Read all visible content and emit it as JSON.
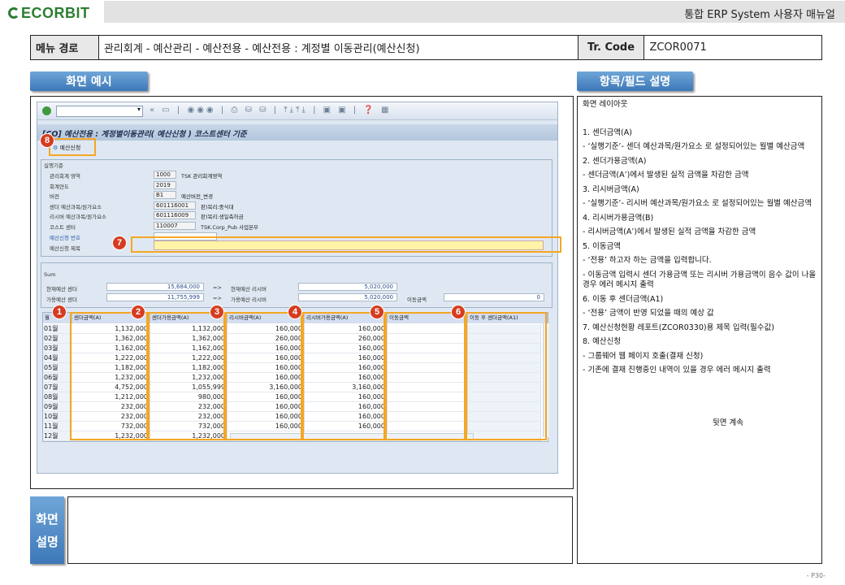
{
  "header": {
    "logo_text": "ECORBIT",
    "doc_title": "통합 ERP System 사용자 매뉴얼"
  },
  "menu": {
    "path_label": "메뉴 경로",
    "path_value": "관리회계 - 예산관리 - 예산전용 - 예산전용 : 계정별 이동관리(예산신청)",
    "tcode_label": "Tr. Code",
    "tcode_value": "ZCOR0071"
  },
  "sections": {
    "screen_example": "화면 예시",
    "field_desc": "항목/필드 설명",
    "screen_expl": [
      "화면",
      "설명"
    ]
  },
  "sap": {
    "title": "[CO] 예산전용 : 계정별이동관리( 예산신청 ) 코스트센터 기준",
    "app_button": "예산신청",
    "criteria_group": "실행기준",
    "fields": [
      {
        "label": "관리회계 영역",
        "value": "1000",
        "desc": "TSK 관리회계영역"
      },
      {
        "label": "회계연도",
        "value": "2019",
        "desc": ""
      },
      {
        "label": "버전",
        "value": "B1",
        "desc": "예산버전_변경"
      },
      {
        "label": "센더 예산과목/원가요소",
        "value": "601116001",
        "desc": "판)복리:중식대"
      },
      {
        "label": "리시버 예산과목/원가요소",
        "value": "601116009",
        "desc": "판)복리:생일축하금"
      },
      {
        "label": "코스트 센터",
        "value": "110007",
        "desc": "TSK.Corp_Pub 사업본부"
      }
    ],
    "req_no_label": "예산신청 번호",
    "req_title_label": "예산신청 제목",
    "sum_group": "Sum",
    "sum": {
      "cur_sender_label": "현재예산 센더",
      "cur_sender_value": "15,684,000",
      "cur_receiver_label": "현재예산 리시버",
      "cur_receiver_value": "5,020,000",
      "avail_sender_label": "가용예산 센더",
      "avail_sender_value": "11,755,999",
      "avail_receiver_label": "가용예산 리시버",
      "avail_receiver_value": "5,020,000",
      "move_label": "이동금액",
      "move_value": "0",
      "arrow": "=>"
    },
    "grid_headers": [
      "월",
      "센더금액(A)",
      "센더가용금액(A)",
      "리시버금액(A)",
      "리시버가용금액(A)",
      "이동금액",
      "이동 후 센더금액(A1)"
    ],
    "rows": [
      {
        "m": "01월",
        "a": "1,132,000",
        "b": "1,132,000",
        "c": "160,000",
        "d": "160,000"
      },
      {
        "m": "02월",
        "a": "1,362,000",
        "b": "1,362,000",
        "c": "260,000",
        "d": "260,000"
      },
      {
        "m": "03월",
        "a": "1,162,000",
        "b": "1,162,000",
        "c": "160,000",
        "d": "160,000"
      },
      {
        "m": "04월",
        "a": "1,222,000",
        "b": "1,222,000",
        "c": "160,000",
        "d": "160,000"
      },
      {
        "m": "05월",
        "a": "1,182,000",
        "b": "1,182,000",
        "c": "160,000",
        "d": "160,000"
      },
      {
        "m": "06월",
        "a": "1,232,000",
        "b": "1,232,000",
        "c": "160,000",
        "d": "160,000"
      },
      {
        "m": "07월",
        "a": "4,752,000",
        "b": "1,055,999",
        "c": "3,160,000",
        "d": "3,160,000"
      },
      {
        "m": "08월",
        "a": "1,212,000",
        "b": "980,000",
        "c": "160,000",
        "d": "160,000"
      },
      {
        "m": "09월",
        "a": "232,000",
        "b": "232,000",
        "c": "160,000",
        "d": "160,000"
      },
      {
        "m": "10월",
        "a": "232,000",
        "b": "232,000",
        "c": "160,000",
        "d": "160,000"
      },
      {
        "m": "11월",
        "a": "732,000",
        "b": "732,000",
        "c": "160,000",
        "d": "160,000"
      },
      {
        "m": "12월",
        "a": "1,232,000",
        "b": "1,232,000",
        "c": "160,000",
        "d": "160,000"
      }
    ],
    "markers": [
      "1",
      "2",
      "3",
      "4",
      "5",
      "6",
      "7",
      "8"
    ]
  },
  "desc": {
    "heading": "화면 레이아웃",
    "items": [
      "1.    센더금액(A)",
      "  - ‘실행기준’- 센더 예산과목/원가요소 로 설정되어있는 월별 예산금액",
      "2.  센더가용금액(A)",
      "  - 센더금액(A’)에서 발생된 실적 금액을 차감한 금액",
      "3.  리시버금액(A)",
      "  - ‘실행기준’- 리시버 예산과목/원가요소 로 설정되어있는 월별 예산금액",
      "4.     리시버가용금액(B)",
      " - 리시버금액(A’)에서 발생된 실적 금액을 차감한 금액",
      "5. 이동금액",
      "  - ‘전용’ 하고자 하는 금액을 입력합니다.",
      "  - 이동금액 입력시 센더 가용금액 또는 리시버 가용금액이 음수 값이 나올 경우 에러 메시지 출력",
      "6.  이동 후 센더금액(A1)",
      "  - ‘전용’ 금액이 반영 되었을 때의 예상 값",
      "7. 예산신청현황 레포트(ZCOR0330)용 제목 입력(필수값)",
      "8. 예산신청",
      " - 그룹웨어 웹 페이지 호출(결재 신청)",
      " - 기존에 결재 진행중인 내역이 있을 경우 에러 메시지 출력"
    ],
    "continued": "뒷면 계속"
  },
  "page_number": "- P30-"
}
